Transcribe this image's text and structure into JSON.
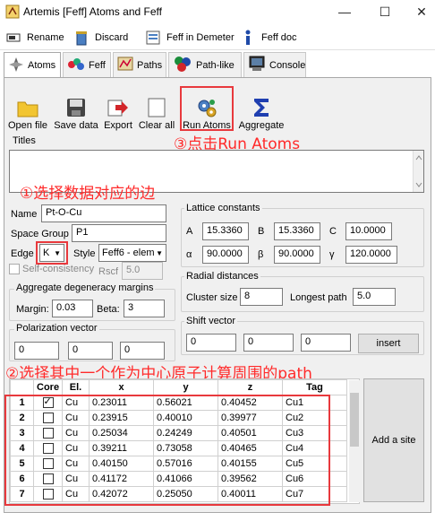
{
  "window": {
    "title": "Artemis [Feff] Atoms and Feff",
    "minimize": "—",
    "maximize": "☐",
    "close": "✕"
  },
  "menu": {
    "items": [
      {
        "label": "Rename",
        "icon": "rename-icon"
      },
      {
        "label": "Discard",
        "icon": "trash-icon"
      },
      {
        "label": "Feff in Demeter",
        "icon": "feff-icon"
      },
      {
        "label": "Feff doc",
        "icon": "info-icon"
      }
    ]
  },
  "tabs": [
    {
      "label": "Atoms",
      "icon": "atoms-icon",
      "active": true
    },
    {
      "label": "Feff",
      "icon": "feff-tab-icon"
    },
    {
      "label": "Paths",
      "icon": "paths-icon"
    },
    {
      "label": "Path-like",
      "icon": "pathlike-icon"
    },
    {
      "label": "Console",
      "icon": "console-icon"
    }
  ],
  "toolbar": {
    "open": "Open file",
    "save": "Save data",
    "export": "Export",
    "clear": "Clear all",
    "run": "Run Atoms",
    "aggregate": "Aggregate"
  },
  "annotations": {
    "a1": "①选择数据对应的边",
    "a2": "②选择其中一个作为中心原子计算周围的path",
    "a3": "③点击Run Atoms"
  },
  "titles": {
    "label": "Titles",
    "value": ""
  },
  "form": {
    "name_label": "Name",
    "name_value": "Pt-O-Cu",
    "sg_label": "Space Group",
    "sg_value": "P1",
    "edge_label": "Edge",
    "edge_value": "K",
    "style_label": "Style",
    "style_value": "Feff6 - elem",
    "selfcons_label": "Self-consistency",
    "rscf_label": "Rscf",
    "rscf_value": "5.0"
  },
  "lattice": {
    "label": "Lattice constants",
    "a_label": "A",
    "a": "15.3360",
    "b_label": "B",
    "b": "15.3360",
    "c_label": "C",
    "c": "10.0000",
    "alpha_label": "α",
    "alpha": "90.0000",
    "beta_label": "β",
    "beta": "90.0000",
    "gamma_label": "γ",
    "gamma": "120.0000"
  },
  "aggregate": {
    "label": "Aggregate degeneracy margins",
    "margin_label": "Margin:",
    "margin": "0.03",
    "beta_label": "Beta:",
    "beta": "3"
  },
  "radial": {
    "label": "Radial distances",
    "cluster_label": "Cluster size",
    "cluster": "8",
    "path_label": "Longest path",
    "path": "5.0"
  },
  "polarization": {
    "label": "Polarization vector",
    "v": [
      "0",
      "0",
      "0"
    ]
  },
  "shift": {
    "label": "Shift vector",
    "v": [
      "0",
      "0",
      "0"
    ],
    "insert": "insert"
  },
  "table": {
    "columns": [
      "",
      "Core",
      "El.",
      "x",
      "y",
      "z",
      "Tag"
    ],
    "rows": [
      {
        "n": "1",
        "core": true,
        "el": "Cu",
        "x": "0.23011",
        "y": "0.56021",
        "z": "0.40452",
        "tag": "Cu1"
      },
      {
        "n": "2",
        "core": false,
        "el": "Cu",
        "x": "0.23915",
        "y": "0.40010",
        "z": "0.39977",
        "tag": "Cu2"
      },
      {
        "n": "3",
        "core": false,
        "el": "Cu",
        "x": "0.25034",
        "y": "0.24249",
        "z": "0.40501",
        "tag": "Cu3"
      },
      {
        "n": "4",
        "core": false,
        "el": "Cu",
        "x": "0.39211",
        "y": "0.73058",
        "z": "0.40465",
        "tag": "Cu4"
      },
      {
        "n": "5",
        "core": false,
        "el": "Cu",
        "x": "0.40150",
        "y": "0.57016",
        "z": "0.40155",
        "tag": "Cu5"
      },
      {
        "n": "6",
        "core": false,
        "el": "Cu",
        "x": "0.41172",
        "y": "0.41066",
        "z": "0.39562",
        "tag": "Cu6"
      },
      {
        "n": "7",
        "core": false,
        "el": "Cu",
        "x": "0.42072",
        "y": "0.25050",
        "z": "0.40011",
        "tag": "Cu7"
      }
    ],
    "add_site": "Add a site"
  }
}
